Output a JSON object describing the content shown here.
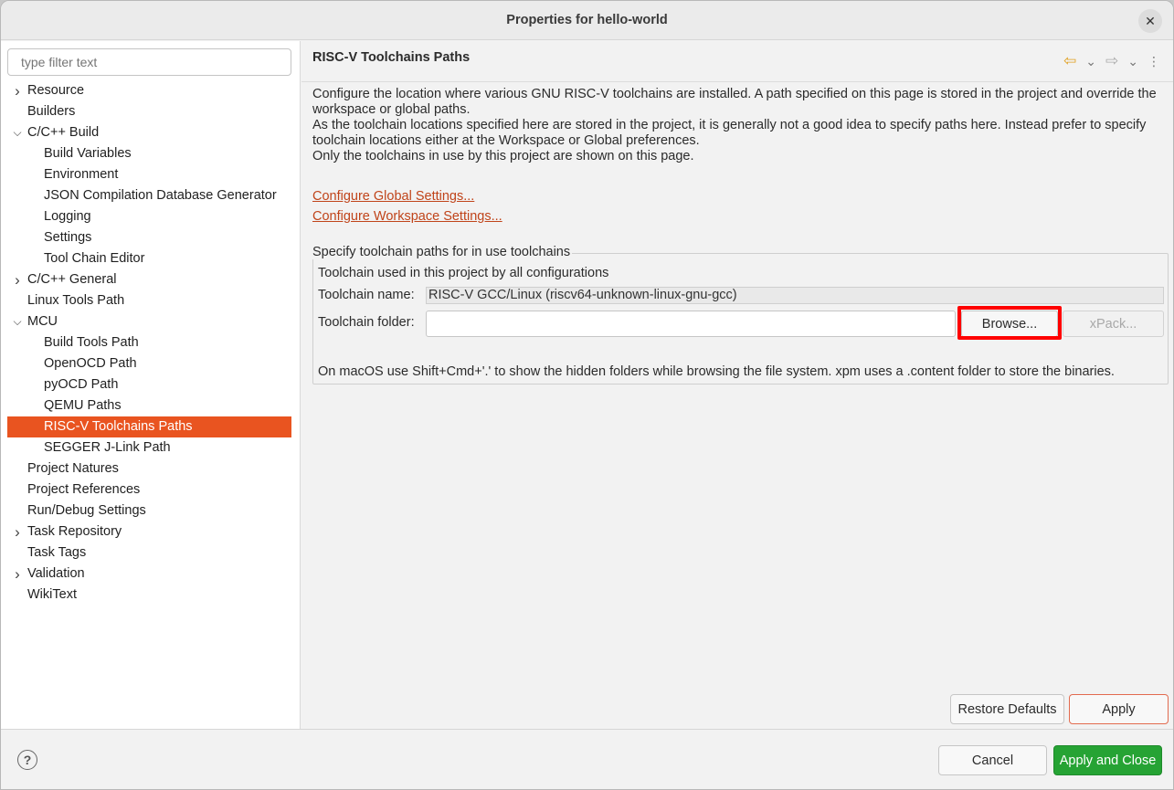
{
  "window": {
    "title": "Properties for hello-world",
    "close_glyph": "✕"
  },
  "left": {
    "filter_placeholder": "type filter text",
    "tree": [
      {
        "label": "Resource",
        "level": 0,
        "expandable": true,
        "expanded": false
      },
      {
        "label": "Builders",
        "level": 0,
        "expandable": false
      },
      {
        "label": "C/C++ Build",
        "level": 0,
        "expandable": true,
        "expanded": true
      },
      {
        "label": "Build Variables",
        "level": 1
      },
      {
        "label": "Environment",
        "level": 1
      },
      {
        "label": "JSON Compilation Database Generator",
        "level": 1
      },
      {
        "label": "Logging",
        "level": 1
      },
      {
        "label": "Settings",
        "level": 1
      },
      {
        "label": "Tool Chain Editor",
        "level": 1
      },
      {
        "label": "C/C++ General",
        "level": 0,
        "expandable": true,
        "expanded": false
      },
      {
        "label": "Linux Tools Path",
        "level": 0,
        "expandable": false
      },
      {
        "label": "MCU",
        "level": 0,
        "expandable": true,
        "expanded": true
      },
      {
        "label": "Build Tools Path",
        "level": 1
      },
      {
        "label": "OpenOCD Path",
        "level": 1
      },
      {
        "label": "pyOCD Path",
        "level": 1
      },
      {
        "label": "QEMU Paths",
        "level": 1
      },
      {
        "label": "RISC-V Toolchains Paths",
        "level": 1,
        "selected": true
      },
      {
        "label": "SEGGER J-Link Path",
        "level": 1
      },
      {
        "label": "Project Natures",
        "level": 0,
        "expandable": false
      },
      {
        "label": "Project References",
        "level": 0,
        "expandable": false
      },
      {
        "label": "Run/Debug Settings",
        "level": 0,
        "expandable": false
      },
      {
        "label": "Task Repository",
        "level": 0,
        "expandable": true,
        "expanded": false
      },
      {
        "label": "Task Tags",
        "level": 0,
        "expandable": false
      },
      {
        "label": "Validation",
        "level": 0,
        "expandable": true,
        "expanded": false
      },
      {
        "label": "WikiText",
        "level": 0,
        "expandable": false
      }
    ]
  },
  "right": {
    "page_title": "RISC-V Toolchains Paths",
    "description": [
      "Configure the location where various GNU RISC-V toolchains are installed. A path specified on this page is stored in the project and override the workspace or global paths.",
      "As the toolchain locations specified here are stored in the project, it is generally not a good idea to specify paths here. Instead prefer to specify toolchain locations either at the Workspace or Global preferences.",
      "Only the toolchains in use by this project are shown on this page."
    ],
    "link_global": "Configure Global Settings...",
    "link_workspace": "Configure Workspace Settings...",
    "group_label": "Specify toolchain paths for in use toolchains",
    "group_subtitle": "Toolchain used in this project by all configurations",
    "toolchain_name_label": "Toolchain name:",
    "toolchain_name_value": "RISC-V GCC/Linux (riscv64-unknown-linux-gnu-gcc)",
    "toolchain_folder_label": "Toolchain folder:",
    "toolchain_folder_value": "",
    "browse_label": "Browse...",
    "xpack_label": "xPack...",
    "hint": "On macOS use Shift+Cmd+'.' to show the hidden folders while browsing the file system. xpm uses a .content folder to store the binaries.",
    "restore_defaults_label": "Restore Defaults",
    "apply_label": "Apply"
  },
  "footer": {
    "help_glyph": "?",
    "cancel_label": "Cancel",
    "apply_close_label": "Apply and Close"
  },
  "colors": {
    "selection": "#e95420",
    "link": "#c0441a",
    "primary_button": "#26a334",
    "highlight": "#ff0000"
  },
  "icons": {
    "back": "back-arrow-icon",
    "forward": "forward-arrow-icon",
    "menu": "kebab-menu-icon"
  }
}
